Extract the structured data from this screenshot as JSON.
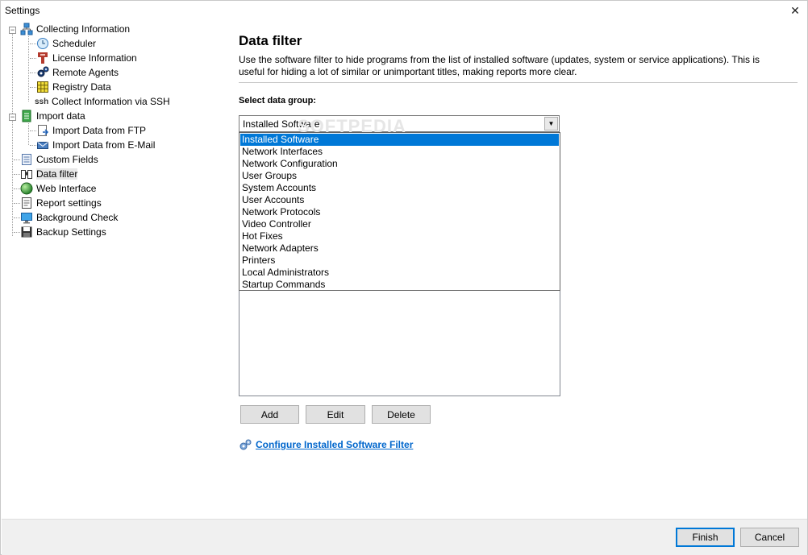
{
  "window": {
    "title": "Settings"
  },
  "tree": {
    "collecting": {
      "label": "Collecting Information",
      "children": [
        "Scheduler",
        "License Information",
        "Remote Agents",
        "Registry Data",
        "Collect Information via SSH"
      ]
    },
    "ssh_prefix": "ssh",
    "import": {
      "label": "Import data",
      "children": [
        "Import Data from FTP",
        "Import Data from E-Mail"
      ]
    },
    "roots": [
      "Custom Fields",
      "Data filter",
      "Web Interface",
      "Report settings",
      "Background Check",
      "Backup Settings"
    ],
    "selected": "Data filter"
  },
  "panel": {
    "title": "Data filter",
    "description": "Use the software filter to hide programs from the list of installed software (updates, system or service applications). This is useful for hiding a lot of similar or unimportant titles, making reports more clear.",
    "group_label": "Select data group:",
    "combo_value": "Installed Software",
    "watermark": "SOFTPEDIA",
    "options": [
      "Installed Software",
      "Network Interfaces",
      "Network Configuration",
      "User Groups",
      "System Accounts",
      "User Accounts",
      "Network Protocols",
      "Video Controller",
      "Hot Fixes",
      "Network Adapters",
      "Printers",
      "Local Administrators",
      "Startup Commands"
    ],
    "buttons": {
      "add": "Add",
      "edit": "Edit",
      "delete": "Delete"
    },
    "configure_link": "Configure Installed Software Filter"
  },
  "footer": {
    "finish": "Finish",
    "cancel": "Cancel"
  },
  "colors": {
    "selection": "#0078d7",
    "link": "#0066cc"
  }
}
